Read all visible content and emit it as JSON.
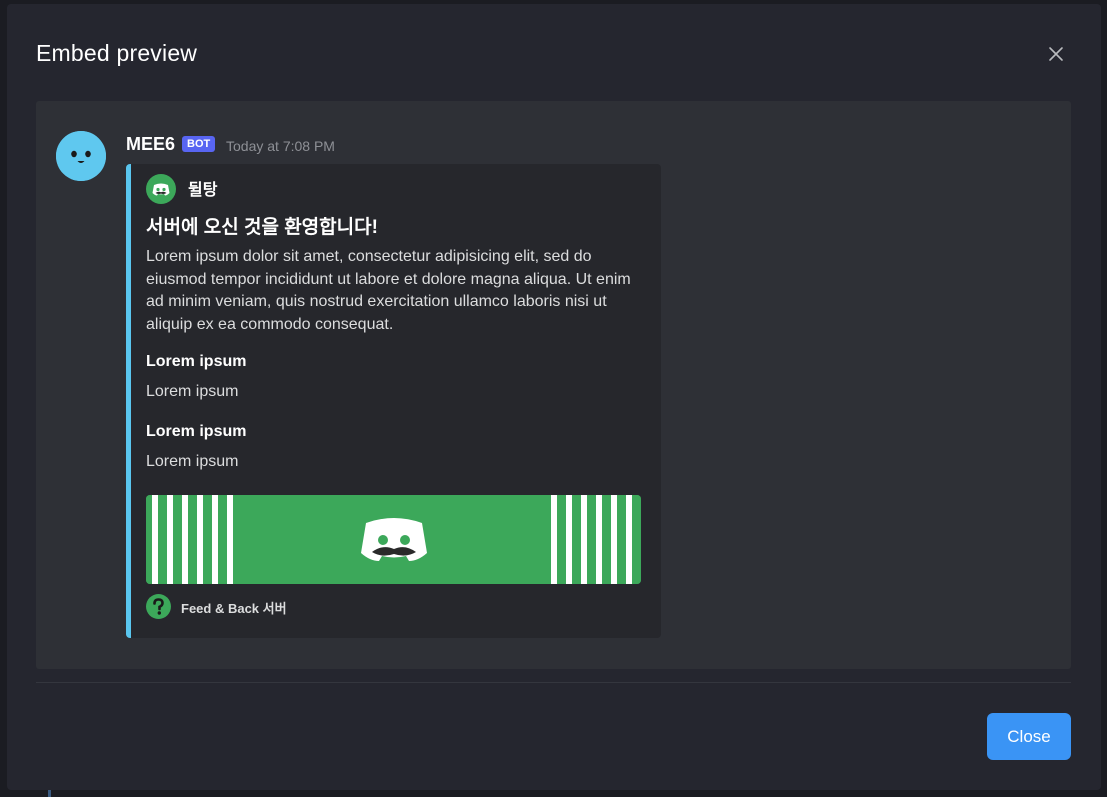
{
  "modal": {
    "title": "Embed preview",
    "close_button": "Close"
  },
  "message": {
    "username": "MEE6",
    "badge": "BOT",
    "timestamp": "Today at 7:08 PM",
    "avatar_color": "#5fc8ef"
  },
  "embed": {
    "accent_color": "#5ac6ef",
    "author": "뒬탕",
    "title": "서버에 오신 것을 환영합니다!",
    "description": "Lorem ipsum dolor sit amet, consectetur adipisicing elit, sed do eiusmod tempor incididunt ut labore et dolore magna aliqua. Ut enim ad minim veniam, quis nostrud exercitation ullamco laboris nisi ut aliquip ex ea commodo consequat.",
    "fields": [
      {
        "name": "Lorem ipsum",
        "value": "Lorem ipsum"
      },
      {
        "name": "Lorem ipsum",
        "value": "Lorem ipsum"
      }
    ],
    "image_color": "#3ca85a",
    "footer": "Feed & Back 서버"
  },
  "colors": {
    "modal_bg": "#25262f",
    "preview_bg": "#2e3036",
    "embed_bg": "#26272c",
    "bot_badge": "#5865f2",
    "close_button": "#3a94f5"
  }
}
